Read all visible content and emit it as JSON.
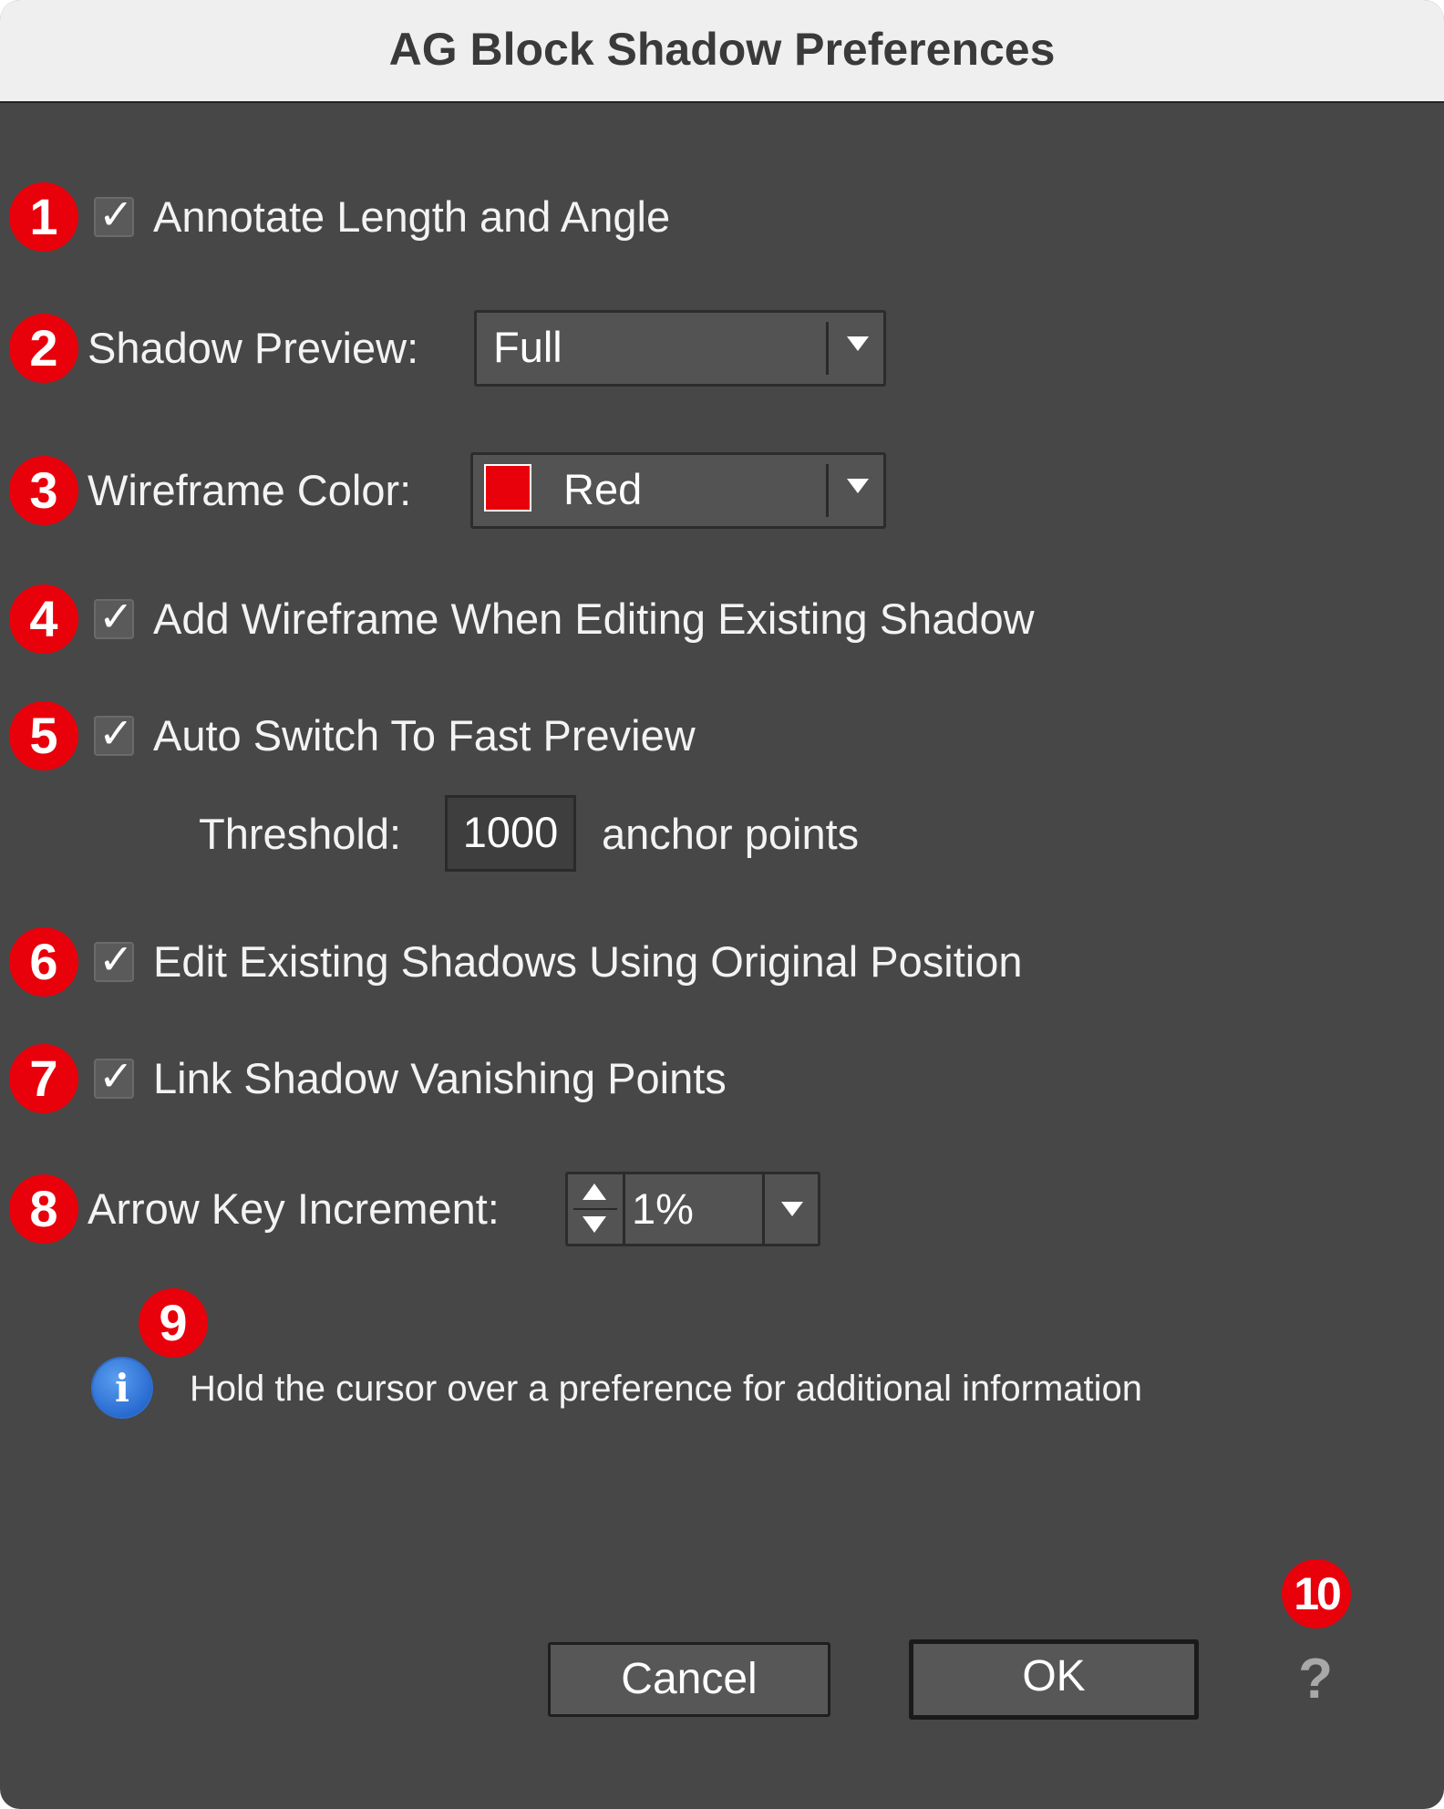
{
  "window": {
    "title": "AG Block Shadow Preferences"
  },
  "markers": [
    "1",
    "2",
    "3",
    "4",
    "5",
    "6",
    "7",
    "8",
    "9",
    "10"
  ],
  "annotate": {
    "label": "Annotate Length and Angle",
    "checked": true
  },
  "shadow_preview": {
    "label": "Shadow Preview:",
    "value": "Full"
  },
  "wireframe_color": {
    "label": "Wireframe Color:",
    "value": "Red",
    "swatch": "#e8000b"
  },
  "add_wireframe": {
    "label": "Add Wireframe When Editing Existing Shadow",
    "checked": true
  },
  "auto_switch": {
    "label": "Auto Switch To Fast Preview",
    "checked": true
  },
  "threshold": {
    "label": "Threshold:",
    "value": "1000",
    "unit": "anchor points"
  },
  "edit_existing": {
    "label": "Edit Existing Shadows Using Original Position",
    "checked": true
  },
  "link_vanishing": {
    "label": "Link Shadow Vanishing Points",
    "checked": true
  },
  "arrow_key": {
    "label": "Arrow Key Increment:",
    "value": "1%"
  },
  "info": {
    "icon": "info-icon",
    "text": "Hold the cursor over a preference for additional information"
  },
  "buttons": {
    "cancel": "Cancel",
    "ok": "OK",
    "help": "?"
  },
  "colors": {
    "marker": "#e8000b",
    "background": "#474747",
    "titlebar": "#efefef"
  }
}
